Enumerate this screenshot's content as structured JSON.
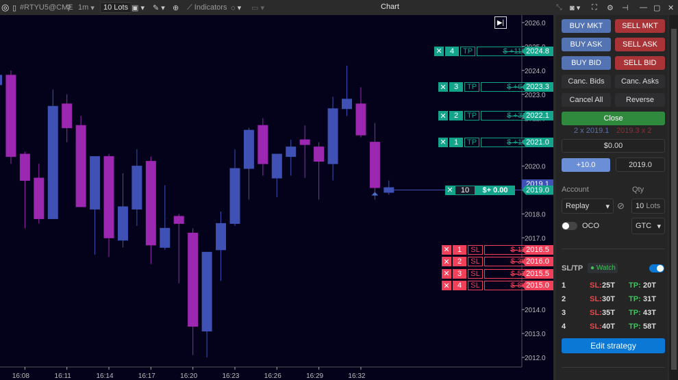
{
  "toolbar": {
    "symbol": "#RTYU5@CME",
    "timeframe": "1m",
    "lots": "10 Lots",
    "indicators": "Indicators",
    "title": "Chart"
  },
  "colors": {
    "bg": "#03021a",
    "up": "#3f51b5",
    "down": "#9c27b0",
    "tp": "#14a38b",
    "sl": "#f0405a",
    "buy": "#5473b3",
    "sell": "#a83438",
    "close": "#2f8a3e",
    "accent": "#0a78d4"
  },
  "chart_data": {
    "type": "candlestick",
    "ylim": [
      2011.7,
      2026.2
    ],
    "yticks": [
      "2026.0",
      "2025.0",
      "2024.0",
      "2023.0",
      "2022.0",
      "2021.0",
      "2020.0",
      "2019.0",
      "2018.0",
      "2017.0",
      "2016.0",
      "2015.0",
      "2014.0",
      "2013.0",
      "2012.0"
    ],
    "xticks": [
      "16:08",
      "16:11",
      "16:14",
      "16:17",
      "16:20",
      "16:23",
      "16:26",
      "16:29",
      "16:32"
    ],
    "candles": [
      {
        "t": "16:06",
        "o": 2023.4,
        "h": 2023.9,
        "l": 2023.3,
        "c": 2023.8
      },
      {
        "t": "16:07",
        "o": 2023.8,
        "h": 2024.0,
        "l": 2020.1,
        "c": 2020.4
      },
      {
        "t": "16:08",
        "o": 2020.5,
        "h": 2020.6,
        "l": 2017.4,
        "c": 2019.4
      },
      {
        "t": "16:09",
        "o": 2019.5,
        "h": 2020.1,
        "l": 2017.6,
        "c": 2017.8
      },
      {
        "t": "16:10",
        "o": 2017.8,
        "h": 2023.2,
        "l": 2017.8,
        "c": 2022.5
      },
      {
        "t": "16:11",
        "o": 2022.6,
        "h": 2023.0,
        "l": 2021.0,
        "c": 2021.6
      },
      {
        "t": "16:12",
        "o": 2021.7,
        "h": 2022.1,
        "l": 2018.3,
        "c": 2018.3
      },
      {
        "t": "16:13",
        "o": 2018.2,
        "h": 2020.4,
        "l": 2016.3,
        "c": 2020.4
      },
      {
        "t": "16:14",
        "o": 2020.4,
        "h": 2020.5,
        "l": 2016.2,
        "c": 2017.0
      },
      {
        "t": "16:15",
        "o": 2016.9,
        "h": 2019.7,
        "l": 2016.6,
        "c": 2018.3
      },
      {
        "t": "16:16",
        "o": 2018.2,
        "h": 2020.7,
        "l": 2017.5,
        "c": 2020.0
      },
      {
        "t": "16:17",
        "o": 2020.2,
        "h": 2020.4,
        "l": 2015.9,
        "c": 2016.7
      },
      {
        "t": "16:18",
        "o": 2016.6,
        "h": 2019.2,
        "l": 2016.5,
        "c": 2017.4
      },
      {
        "t": "16:19",
        "o": 2017.9,
        "h": 2018.0,
        "l": 2015.1,
        "c": 2017.6
      },
      {
        "t": "16:20",
        "o": 2017.2,
        "h": 2017.4,
        "l": 2012.1,
        "c": 2013.3
      },
      {
        "t": "16:21",
        "o": 2013.1,
        "h": 2016.4,
        "l": 2012.0,
        "c": 2016.4
      },
      {
        "t": "16:22",
        "o": 2016.5,
        "h": 2018.1,
        "l": 2015.2,
        "c": 2017.6
      },
      {
        "t": "16:23",
        "o": 2017.6,
        "h": 2020.7,
        "l": 2017.5,
        "c": 2019.9
      },
      {
        "t": "16:24",
        "o": 2019.9,
        "h": 2021.6,
        "l": 2018.6,
        "c": 2021.5
      },
      {
        "t": "16:25",
        "o": 2021.7,
        "h": 2022.0,
        "l": 2019.6,
        "c": 2020.1
      },
      {
        "t": "16:26",
        "o": 2019.5,
        "h": 2020.5,
        "l": 2018.7,
        "c": 2020.5
      },
      {
        "t": "16:27",
        "o": 2020.4,
        "h": 2021.1,
        "l": 2019.6,
        "c": 2020.8
      },
      {
        "t": "16:28",
        "o": 2021.1,
        "h": 2021.7,
        "l": 2019.5,
        "c": 2020.9
      },
      {
        "t": "16:29",
        "o": 2020.8,
        "h": 2021.0,
        "l": 2018.6,
        "c": 2020.2
      },
      {
        "t": "16:30",
        "o": 2020.1,
        "h": 2022.9,
        "l": 2019.4,
        "c": 2022.4
      },
      {
        "t": "16:31",
        "o": 2022.4,
        "h": 2024.2,
        "l": 2022.1,
        "c": 2022.8
      },
      {
        "t": "16:32",
        "o": 2022.6,
        "h": 2023.3,
        "l": 2021.2,
        "c": 2021.3
      },
      {
        "t": "16:33",
        "o": 2021.0,
        "h": 2021.8,
        "l": 2018.6,
        "c": 2019.1
      },
      {
        "t": "16:34",
        "o": 2018.9,
        "h": 2019.4,
        "l": 2018.8,
        "c": 2019.1
      }
    ],
    "last_price": "2019.1",
    "position": {
      "qty": "10",
      "pnl": "$+ 0.00",
      "price": "2019.0"
    },
    "take_profits": [
      {
        "n": "4",
        "type": "TP",
        "pnl": "$ +1160.00",
        "price": "2024.8"
      },
      {
        "n": "3",
        "type": "TP",
        "pnl": "$ +645.00",
        "price": "2023.3"
      },
      {
        "n": "2",
        "type": "TP",
        "pnl": "$ +310.00",
        "price": "2022.1"
      },
      {
        "n": "1",
        "type": "TP",
        "pnl": "$ +100.00",
        "price": "2021.0"
      }
    ],
    "stop_losses": [
      {
        "n": "1",
        "type": "SL",
        "pnl": "$-125.00",
        "price": "2016.5"
      },
      {
        "n": "2",
        "type": "SL",
        "pnl": "$-300.00",
        "price": "2016.0"
      },
      {
        "n": "3",
        "type": "SL",
        "pnl": "$-525.00",
        "price": "2015.5"
      },
      {
        "n": "4",
        "type": "SL",
        "pnl": "$-800.00",
        "price": "2015.0"
      }
    ]
  },
  "panel": {
    "buy_mkt": "BUY MKT",
    "sell_mkt": "SELL MKT",
    "buy_ask": "BUY ASK",
    "sell_ask": "SELL ASK",
    "buy_bid": "BUY BID",
    "sell_bid": "SELL BID",
    "canc_bids": "Canc. Bids",
    "canc_asks": "Canc. Asks",
    "cancel_all": "Cancel All",
    "reverse": "Reverse",
    "close": "Close",
    "bid": "2 x 2019.1",
    "ask": "2019.3 x 2",
    "pnl": "$0.00",
    "offset": "+10.0",
    "price": "2019.0",
    "account_label": "Account",
    "account": "Replay",
    "qty_label": "Qty",
    "qty": "10",
    "qty_unit": "Lots",
    "oco": "OCO",
    "tif": "GTC",
    "sltp": "SL/TP",
    "watch": "Watch",
    "sl_label": "SL:",
    "tp_label": "TP:",
    "rows": [
      {
        "n": "1",
        "sl": "25T",
        "tp": "20T"
      },
      {
        "n": "2",
        "sl": "30T",
        "tp": "31T"
      },
      {
        "n": "3",
        "sl": "35T",
        "tp": "43T"
      },
      {
        "n": "4",
        "sl": "40T",
        "tp": "58T"
      }
    ],
    "edit": "Edit strategy"
  }
}
